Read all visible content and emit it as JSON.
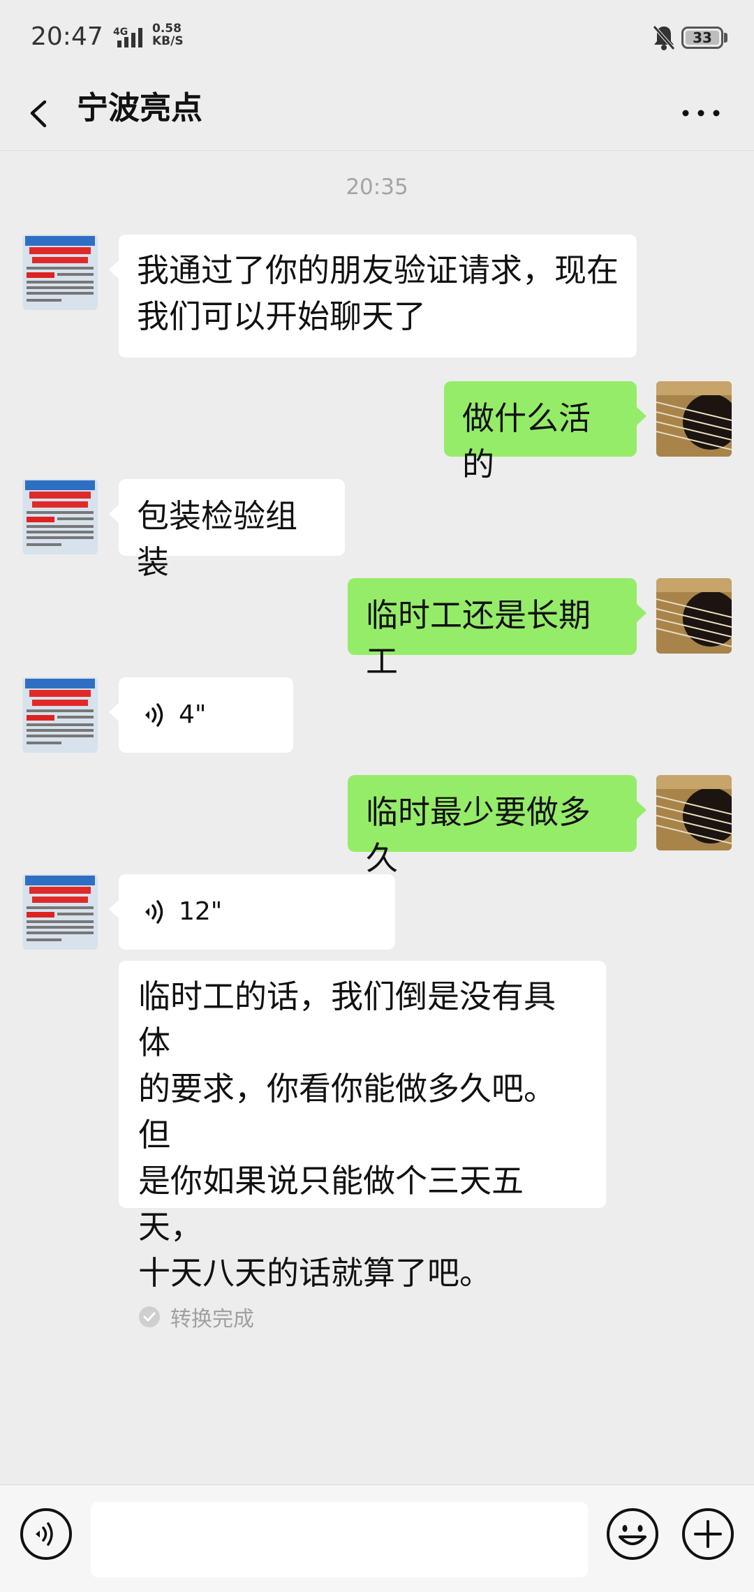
{
  "status_bar": {
    "time": "20:47",
    "network": "4G",
    "speed_value": "0.58",
    "speed_unit": "KB/S",
    "battery": "33",
    "icons": [
      "mute-bell-icon",
      "battery-icon"
    ]
  },
  "header": {
    "title": "宁波亮点",
    "back_icon": "chevron-left-icon",
    "more_icon": "more-dots-icon"
  },
  "chat": {
    "timestamp": "20:35",
    "messages": [
      {
        "from": "contact",
        "type": "text",
        "text_line1": "我通过了你的朋友验证请求，现在",
        "text_line2": "我们可以开始聊天了"
      },
      {
        "from": "me",
        "type": "text",
        "text": "做什么活的"
      },
      {
        "from": "contact",
        "type": "text",
        "text": "包装检验组装"
      },
      {
        "from": "me",
        "type": "text",
        "text": "临时工还是长期工"
      },
      {
        "from": "contact",
        "type": "voice",
        "duration": "4\""
      },
      {
        "from": "me",
        "type": "text",
        "text": "临时最少要做多久"
      },
      {
        "from": "contact",
        "type": "voice",
        "duration": "12\""
      },
      {
        "from": "contact",
        "type": "transcript",
        "lines": [
          "临时工的话，我们倒是没有具体",
          "的要求，你看你能做多久吧。但",
          "是你如果说只能做个三天五天，",
          "十天八天的话就算了吧。"
        ],
        "status": "转换完成"
      }
    ]
  },
  "input_bar": {
    "voice_icon": "voice-input-icon",
    "emoji_icon": "emoji-icon",
    "plus_icon": "plus-icon"
  },
  "colors": {
    "background": "#ededed",
    "incoming_bubble": "#ffffff",
    "outgoing_bubble": "#95ec69",
    "timestamp_text": "#a4a4a4"
  }
}
